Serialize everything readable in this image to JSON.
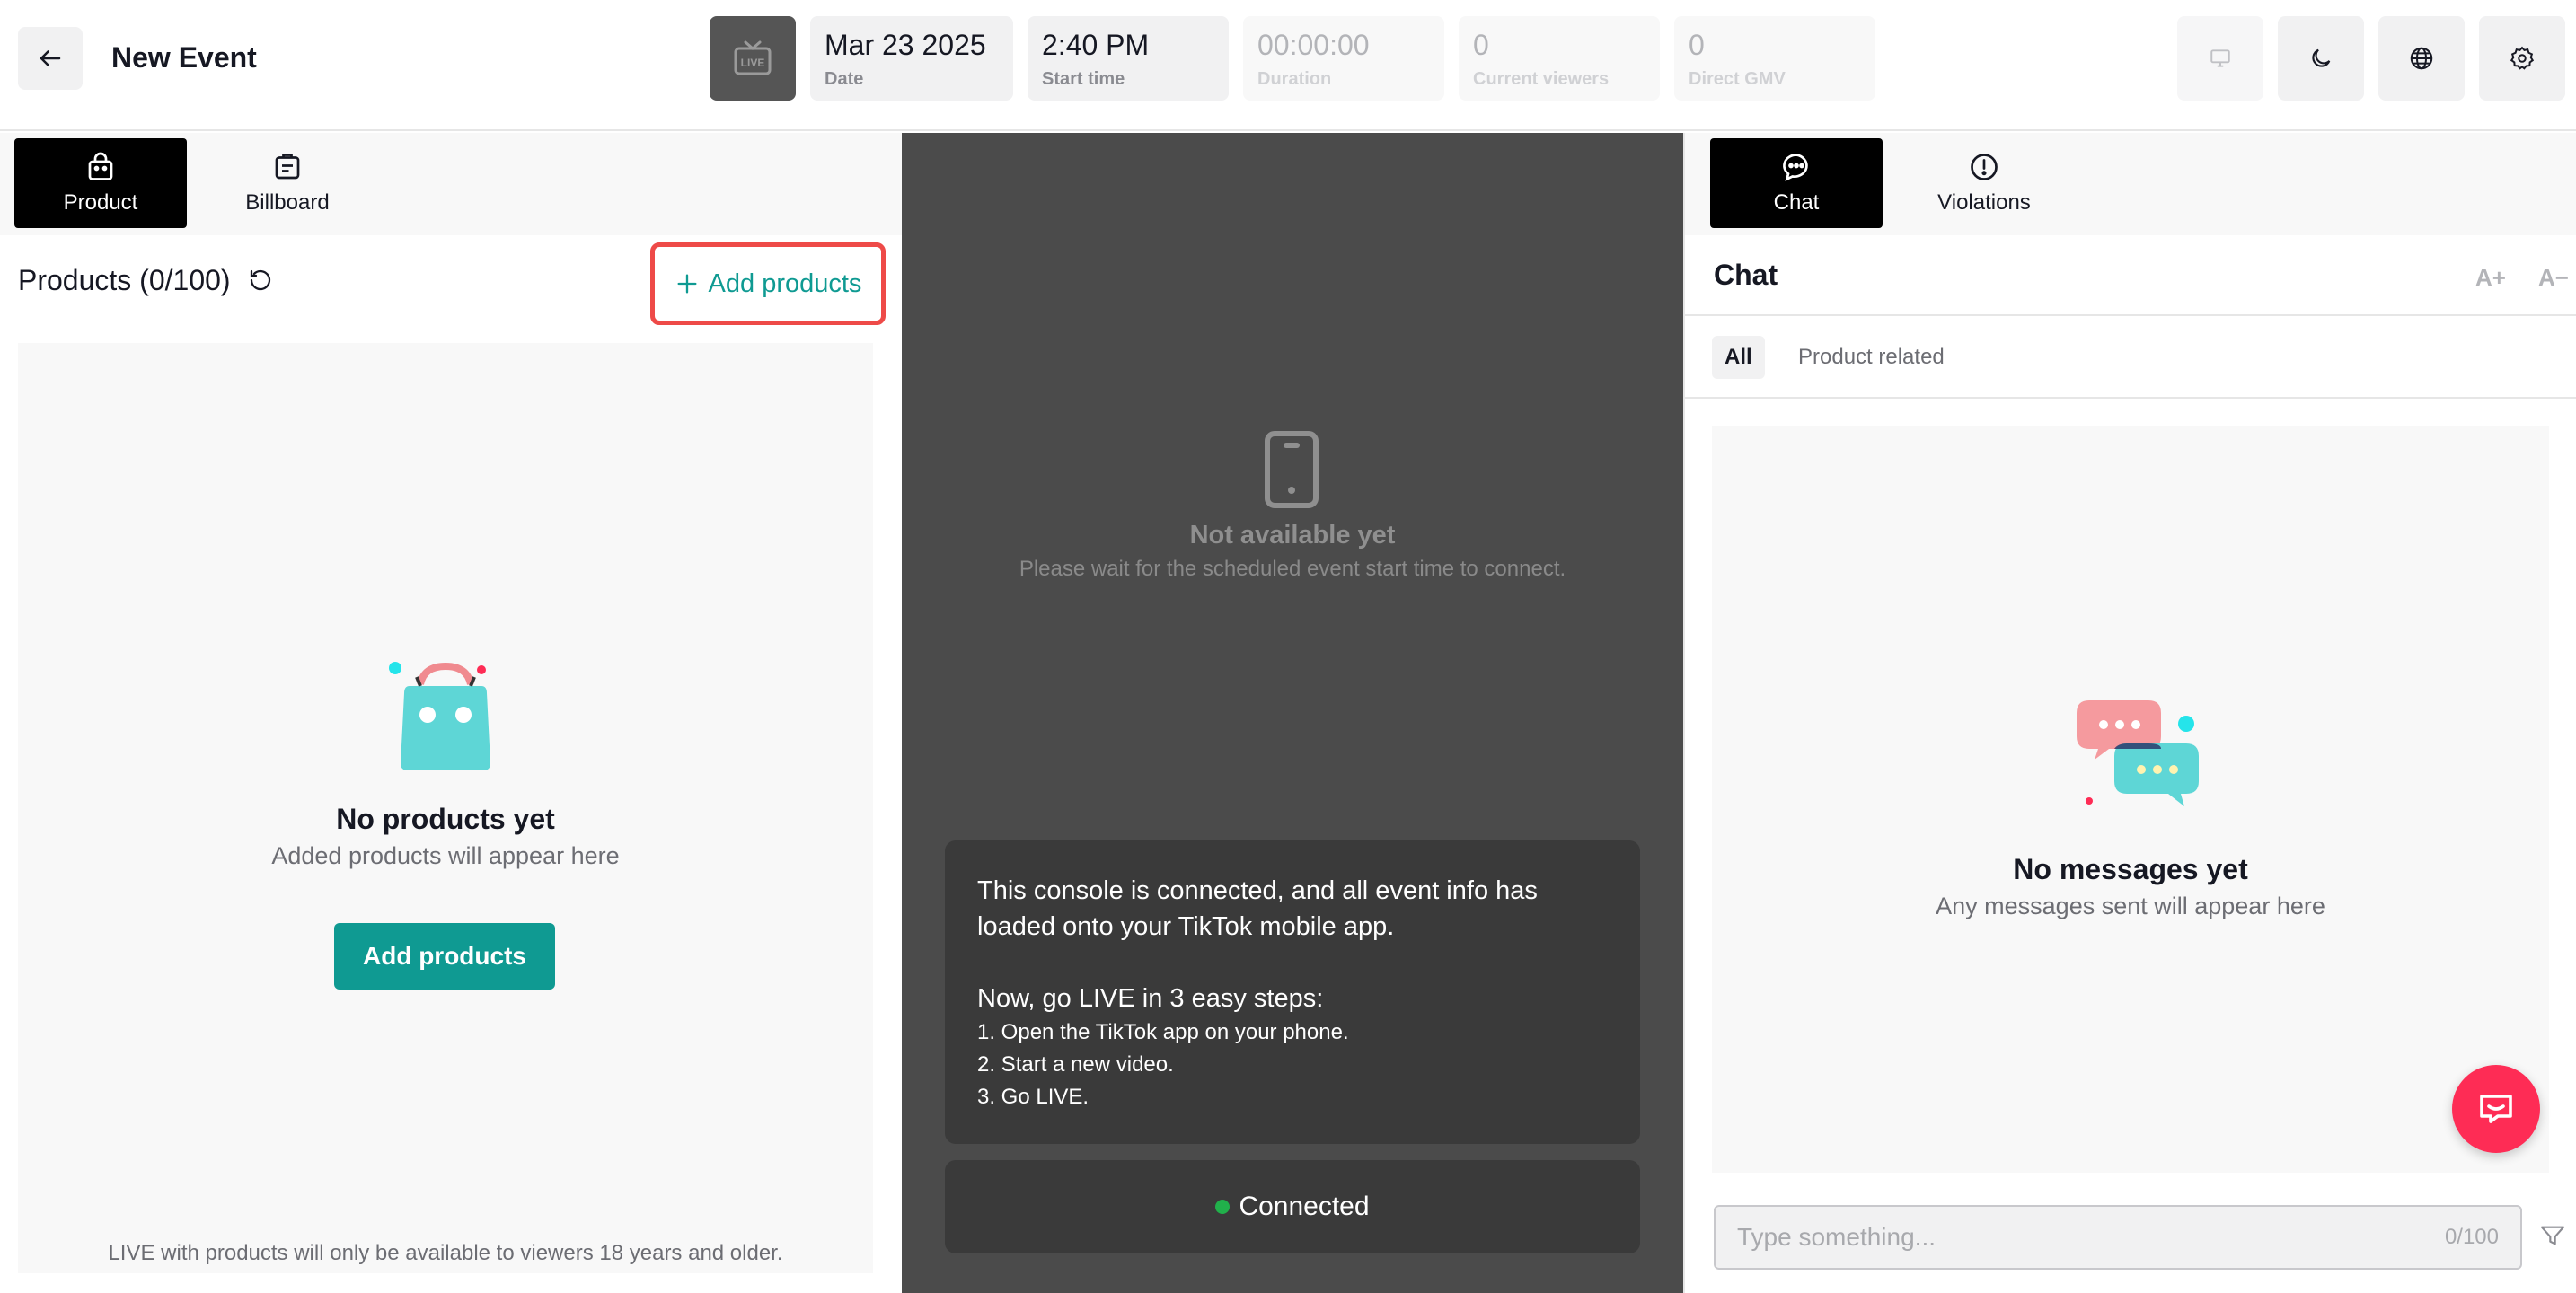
{
  "header": {
    "title": "New Event",
    "live_badge": "LIVE",
    "stats": [
      {
        "value": "Mar 23 2025",
        "label": "Date"
      },
      {
        "value": "2:40 PM",
        "label": "Start time"
      },
      {
        "value": "00:00:00",
        "label": "Duration"
      },
      {
        "value": "0",
        "label": "Current viewers"
      },
      {
        "value": "0",
        "label": "Direct GMV"
      }
    ],
    "icons": [
      "monitor-icon",
      "moon-icon",
      "globe-icon",
      "gear-icon"
    ]
  },
  "left": {
    "tabs": [
      {
        "label": "Product",
        "icon": "shopping-bag-icon",
        "active": true
      },
      {
        "label": "Billboard",
        "icon": "billboard-icon",
        "active": false
      }
    ],
    "products_heading": "Products (0/100)",
    "add_products_link": "Add products",
    "empty_title": "No products yet",
    "empty_subtitle": "Added products will appear here",
    "add_products_button": "Add products",
    "age_note": "LIVE with products will only be available to viewers 18 years and older."
  },
  "center": {
    "not_available_title": "Not available yet",
    "not_available_subtitle": "Please wait for the scheduled event start time to connect.",
    "card_lead": "This console is connected, and all event info has loaded onto your TikTok mobile app.",
    "steps_title": "Now, go LIVE in 3 easy steps:",
    "steps": [
      "1. Open the TikTok app on your phone.",
      "2. Start a new video.",
      "3. Go LIVE."
    ],
    "connection_status": "Connected",
    "status_color": "#21b04b"
  },
  "right": {
    "tabs": [
      {
        "label": "Chat",
        "icon": "chat-bubble-icon",
        "active": true
      },
      {
        "label": "Violations",
        "icon": "alert-circle-icon",
        "active": false
      }
    ],
    "chat_title": "Chat",
    "font_increase": "A+",
    "font_decrease": "A−",
    "filters": [
      {
        "label": "All",
        "active": true
      },
      {
        "label": "Product related",
        "active": false
      }
    ],
    "empty_title": "No messages yet",
    "empty_subtitle": "Any messages sent will appear here",
    "input_placeholder": "Type something...",
    "char_count": "0/100"
  },
  "colors": {
    "accent_teal": "#0f9a92",
    "highlight_red": "#ee4a48",
    "fab_pink": "#fe2c55"
  }
}
